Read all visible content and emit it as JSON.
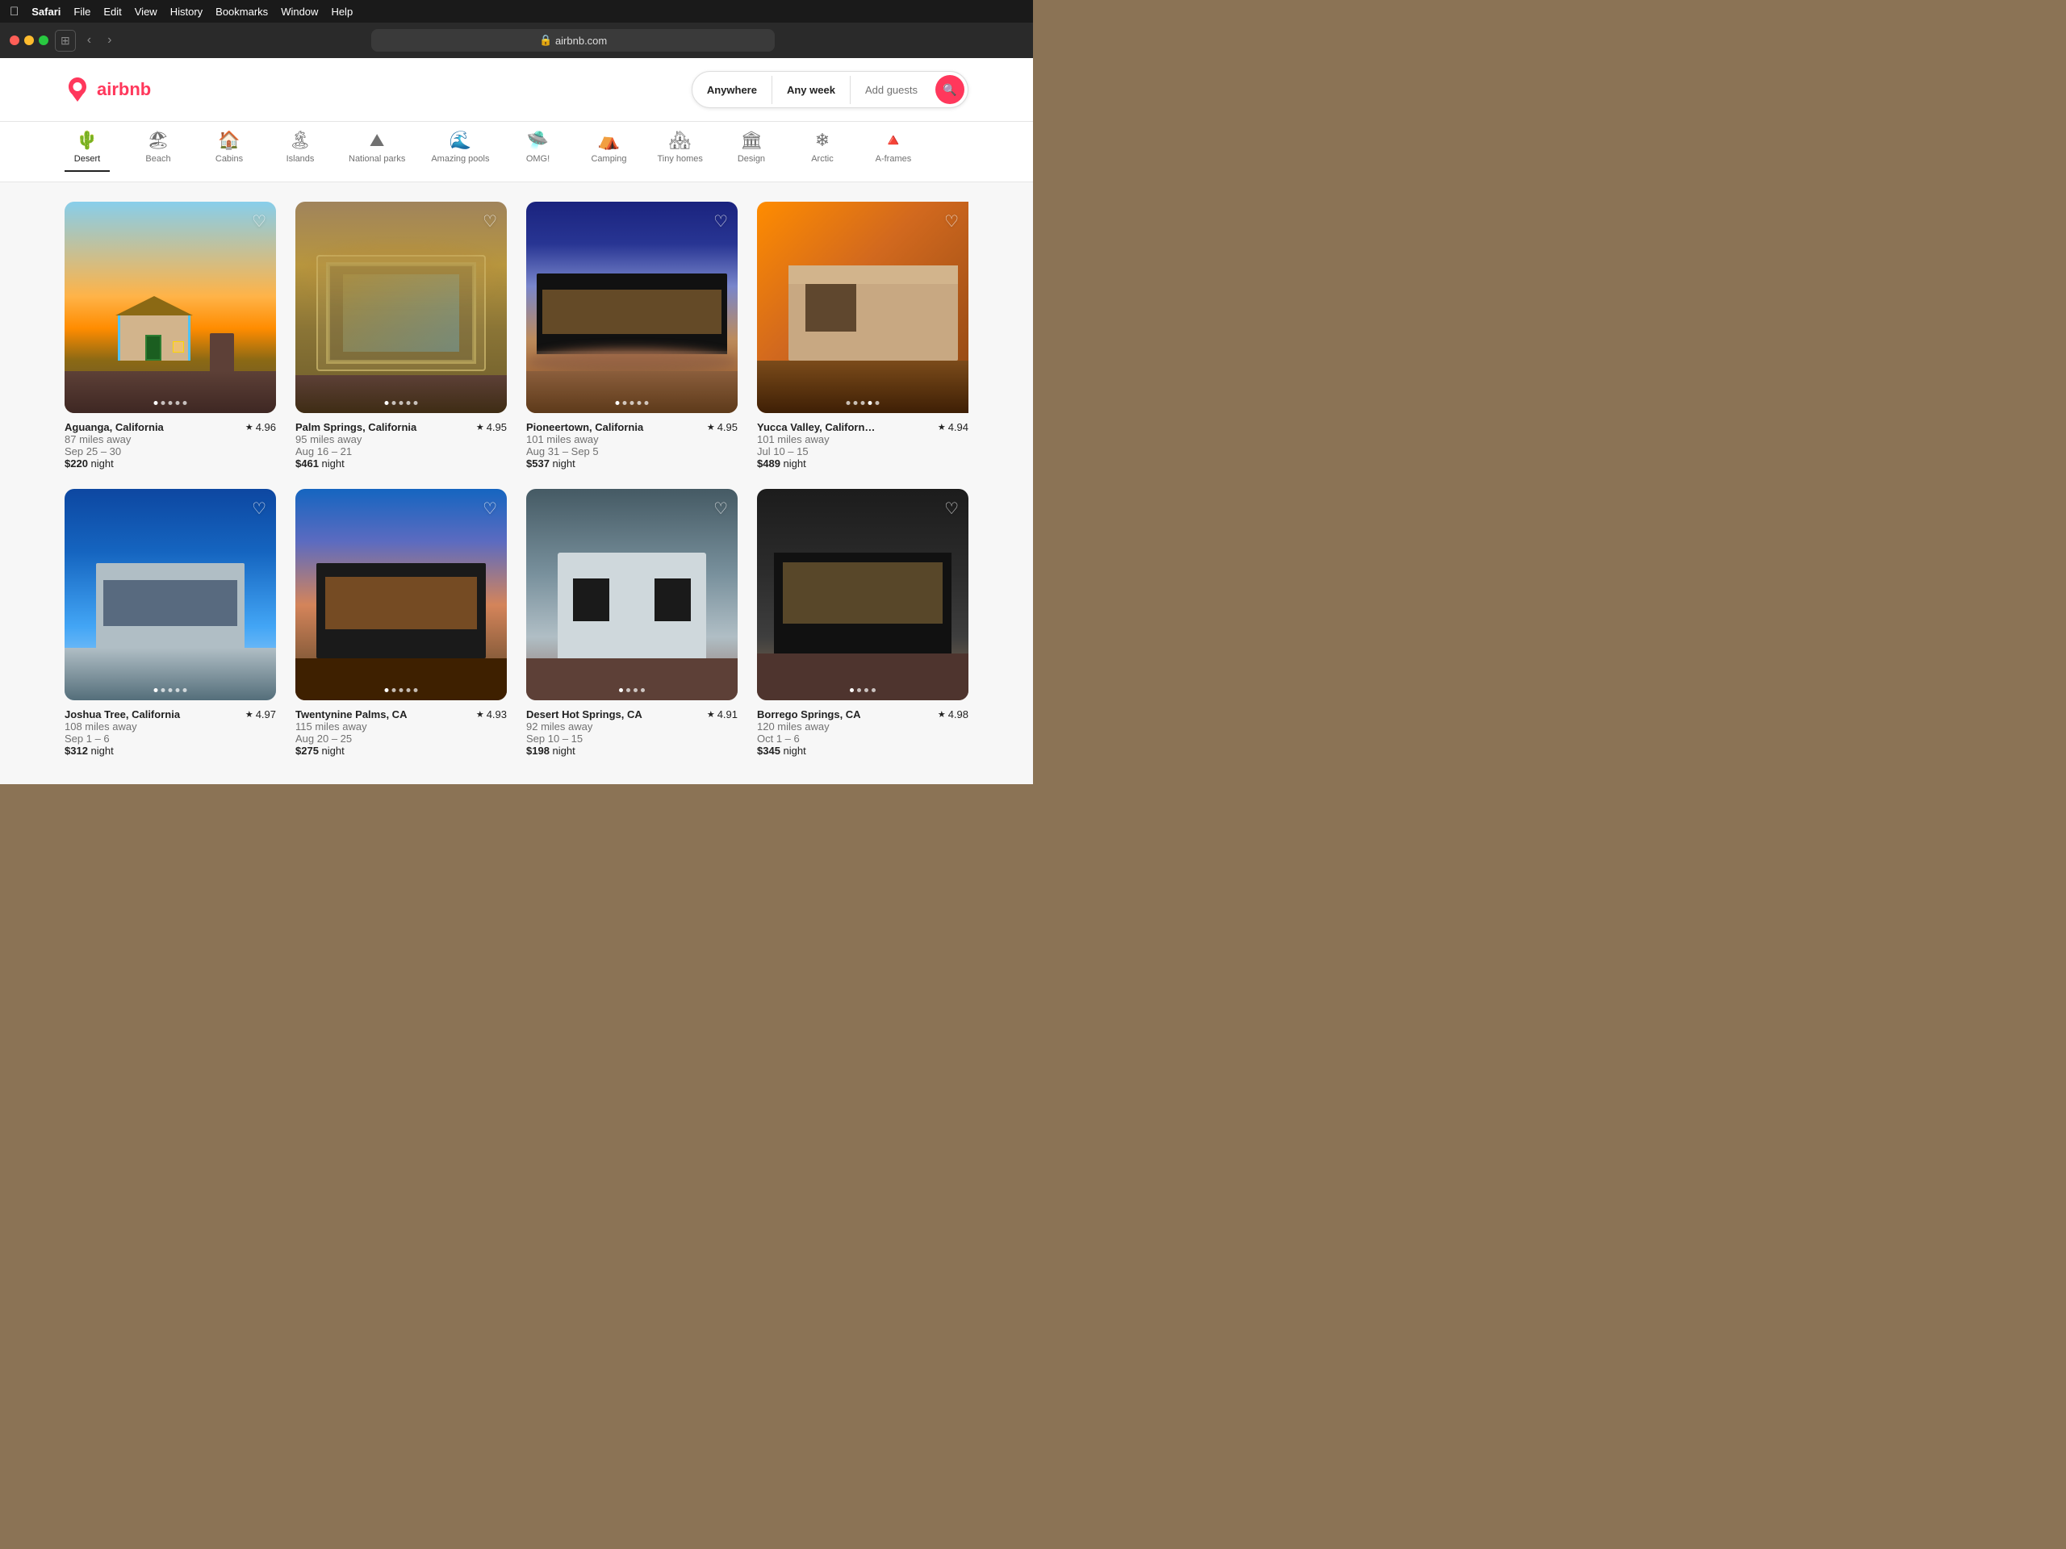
{
  "browser": {
    "menu_items": [
      "",
      "Safari",
      "File",
      "Edit",
      "View",
      "History",
      "Bookmarks",
      "Window",
      "Help"
    ],
    "url": "airbnb.com",
    "lock_symbol": "🔒"
  },
  "airbnb": {
    "logo_text": "airbnb",
    "search": {
      "anywhere": "Anywhere",
      "any_week": "Any week",
      "add_guests": "Add guests"
    },
    "categories": [
      {
        "id": "desert",
        "label": "Desert",
        "icon": "🌵",
        "active": true
      },
      {
        "id": "beach",
        "label": "Beach",
        "icon": "🏖"
      },
      {
        "id": "cabins",
        "label": "Cabins",
        "icon": "🏠"
      },
      {
        "id": "islands",
        "label": "Islands",
        "icon": "🏝"
      },
      {
        "id": "national_parks",
        "label": "National parks",
        "icon": "⛰"
      },
      {
        "id": "amazing_pools",
        "label": "Amazing pools",
        "icon": "🌊"
      },
      {
        "id": "omg",
        "label": "OMG!",
        "icon": "🛸"
      },
      {
        "id": "camping",
        "label": "Camping",
        "icon": "⛺"
      },
      {
        "id": "tiny_homes",
        "label": "Tiny homes",
        "icon": "🏘"
      },
      {
        "id": "design",
        "label": "Design",
        "icon": "🏛"
      },
      {
        "id": "arctic",
        "label": "Arctic",
        "icon": "❄"
      },
      {
        "id": "a_frames",
        "label": "A-frames",
        "icon": "🔺"
      }
    ],
    "listings": [
      {
        "id": 1,
        "location": "Aguanga, California",
        "distance": "87 miles away",
        "dates": "Sep 25 – 30",
        "price": "$220",
        "price_suffix": " night",
        "rating": "4.96",
        "dots": 5,
        "active_dot": 0,
        "card_class": "card-bg-1"
      },
      {
        "id": 2,
        "location": "Palm Springs, California",
        "distance": "95 miles away",
        "dates": "Aug 16 – 21",
        "price": "$461",
        "price_suffix": " night",
        "rating": "4.95",
        "dots": 5,
        "active_dot": 0,
        "card_class": "card-bg-2"
      },
      {
        "id": 3,
        "location": "Pioneertown, California",
        "distance": "101 miles away",
        "dates": "Aug 31 – Sep 5",
        "price": "$537",
        "price_suffix": " night",
        "rating": "4.95",
        "dots": 5,
        "active_dot": 0,
        "card_class": "card-bg-3"
      },
      {
        "id": 4,
        "location": "Yucca Valley, Californ…",
        "distance": "101 miles away",
        "dates": "Jul 10 – 15",
        "price": "$489",
        "price_suffix": " night",
        "rating": "4.94",
        "dots": 5,
        "active_dot": 3,
        "card_class": "card-bg-4"
      },
      {
        "id": 5,
        "location": "Joshua Tree, California",
        "distance": "108 miles away",
        "dates": "Sep 1 – 6",
        "price": "$312",
        "price_suffix": " night",
        "rating": "4.97",
        "dots": 5,
        "active_dot": 0,
        "card_class": "card-bg-5"
      },
      {
        "id": 6,
        "location": "Twentynine Palms, CA",
        "distance": "115 miles away",
        "dates": "Aug 20 – 25",
        "price": "$275",
        "price_suffix": " night",
        "rating": "4.93",
        "dots": 5,
        "active_dot": 0,
        "card_class": "card-bg-6"
      },
      {
        "id": 7,
        "location": "Desert Hot Springs, CA",
        "distance": "92 miles away",
        "dates": "Sep 10 – 15",
        "price": "$198",
        "price_suffix": " night",
        "rating": "4.91",
        "dots": 4,
        "active_dot": 0,
        "card_class": "card-bg-7"
      },
      {
        "id": 8,
        "location": "Borrego Springs, CA",
        "distance": "120 miles away",
        "dates": "Oct 1 – 6",
        "price": "$345",
        "price_suffix": " night",
        "rating": "4.98",
        "dots": 4,
        "active_dot": 0,
        "card_class": "card-bg-8"
      }
    ]
  }
}
